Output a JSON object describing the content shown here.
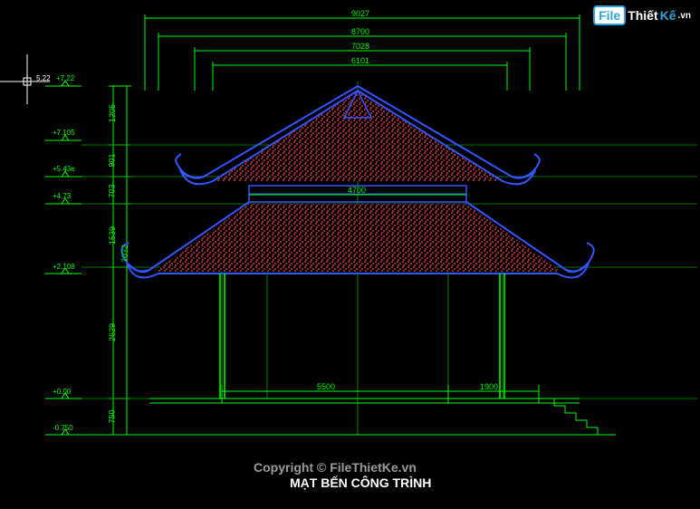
{
  "title": "MẠT BẾN CÔNG TRÌNH",
  "watermark": "Copyright © FileThietKe.vn",
  "logo": {
    "box": "File",
    "word1": "Thiết",
    "word2": "Kế",
    "suffix": ".vn"
  },
  "dimensions": {
    "top1": "9027",
    "top2": "8700",
    "top3": "7028",
    "top4": "6101",
    "middle": "4700",
    "bottom_left": "5500",
    "bottom_right": "1900",
    "v1": "1205",
    "v2": "901",
    "v3": "703",
    "v4": "7032",
    "v5": "1539",
    "v6": "2629",
    "v7": "750"
  },
  "elevations": {
    "e1": "+7.22",
    "e2": "+7.105",
    "e3": "+5.43e",
    "e4": "+4.73",
    "e5": "+2.108",
    "e6": "+0.00",
    "e7": "-0.750"
  },
  "cursor_coord": "5.22"
}
